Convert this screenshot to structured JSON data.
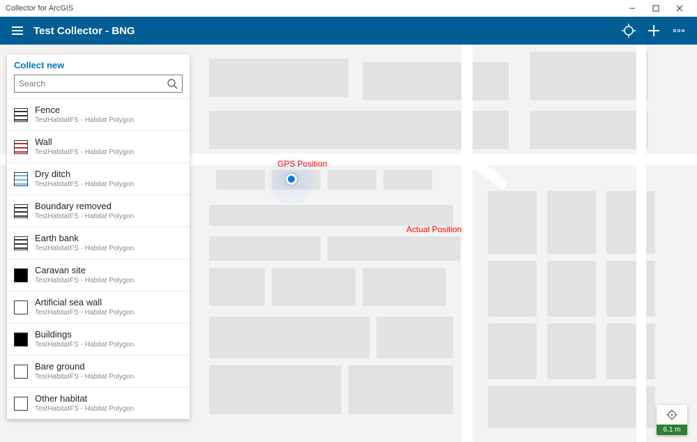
{
  "window": {
    "title": "Collector for ArcGIS"
  },
  "appbar": {
    "title": "Test Collector - BNG"
  },
  "panel": {
    "header": "Collect new",
    "search_placeholder": "Search"
  },
  "features": [
    {
      "name": "Fence",
      "sub": "TestHabitatFS - Habitat Polygon",
      "swatch": "sw-lines"
    },
    {
      "name": "Wall",
      "sub": "TestHabitatFS - Habitat Polygon",
      "swatch": "sw-red"
    },
    {
      "name": "Dry ditch",
      "sub": "TestHabitatFS - Habitat Polygon",
      "swatch": "sw-blue"
    },
    {
      "name": "Boundary removed",
      "sub": "TestHabitatFS - Habitat Polygon",
      "swatch": "sw-lines"
    },
    {
      "name": "Earth bank",
      "sub": "TestHabitatFS - Habitat Polygon",
      "swatch": "sw-lines"
    },
    {
      "name": "Caravan site",
      "sub": "TestHabitatFS - Habitat Polygon",
      "swatch": "sw-black"
    },
    {
      "name": "Artificial sea wall",
      "sub": "TestHabitatFS - Habitat Polygon",
      "swatch": "sw-empty"
    },
    {
      "name": "Buildings",
      "sub": "TestHabitatFS - Habitat Polygon",
      "swatch": "sw-black"
    },
    {
      "name": "Bare ground",
      "sub": "TestHabitatFS - Habitat Polygon",
      "swatch": "sw-empty"
    },
    {
      "name": "Other habitat",
      "sub": "TestHabitatFS - Habitat Polygon",
      "swatch": "sw-empty"
    }
  ],
  "annotations": {
    "gps_label": "GPS Position",
    "actual_label": "Actual Position"
  },
  "accuracy": {
    "value": "6.1 m"
  }
}
